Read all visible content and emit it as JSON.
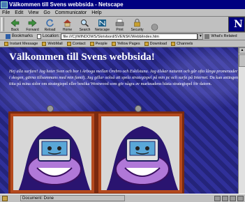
{
  "window": {
    "title": "Välkommen till Svens webbsida - Netscape"
  },
  "menu": [
    "File",
    "Edit",
    "View",
    "Go",
    "Communicator",
    "Help"
  ],
  "toolbar": {
    "buttons": [
      "Back",
      "Forward",
      "Reload",
      "Home",
      "Search",
      "Netscape",
      "Print",
      "Security",
      "Stop"
    ]
  },
  "location_bar": {
    "bookmarks_label": "Bookmarks",
    "location_label": "Location:",
    "url": "file:///C|/WINDOWS/Skrivbord/SVENSK/Webb/index.htm",
    "related_label": "What's Related"
  },
  "personal_toolbar": [
    "Instant Message",
    "WebMail",
    "Contact",
    "People",
    "Yellow Pages",
    "Download",
    "Channels"
  ],
  "page": {
    "heading": "Välkommen till Svens webbsida!",
    "intro": "Hej alla surfare! Jag heter Sven och bor i Arboga mellan Örebro och Eskilstuna. Jag älskar naturen och går ofta långa promenader i skogen, gärna tillsammans med min familj. Jag gillar också att spela strategispel på min pc och surfa på Internet.",
    "intro_rest": "Du kan antingen titta på mina sidor om strategispel eller besöka Westwood som gör några av marknadens bästa strategispel för datorn."
  },
  "statusbar": {
    "status": "Document: Done"
  },
  "colors": {
    "titlebar": "#000080",
    "page_bg": "#2a2a82",
    "frame": "#b44a1e"
  }
}
